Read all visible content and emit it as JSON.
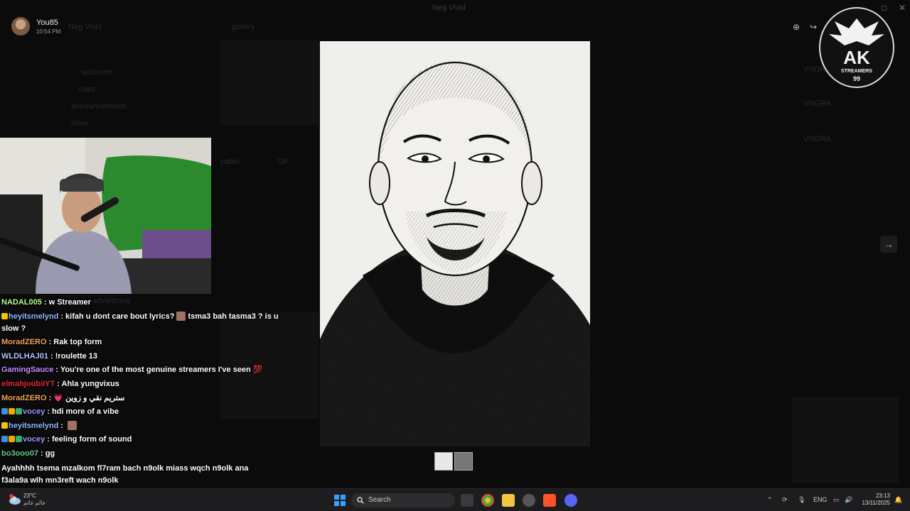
{
  "window": {
    "title": "Neg Vivid",
    "controls": [
      "–",
      "□",
      "✕"
    ]
  },
  "background_app": {
    "server_name": "Neg Vivid",
    "channel": "gallery",
    "sidebar_items": [
      "welcome",
      "rules",
      "announcements",
      "roles",
      "advertising"
    ],
    "post_author": "pablo",
    "post_badge": "OP",
    "members": [
      "VNGRA",
      "VNGRA",
      "VNGRA"
    ]
  },
  "viewer": {
    "user": {
      "name": "You85",
      "time": "10:54 PM"
    },
    "toolbar": [
      {
        "name": "zoom-icon",
        "glyph": "⊕"
      },
      {
        "name": "forward-icon",
        "glyph": "↪"
      }
    ],
    "next_glyph": "→",
    "thumbnails": 2
  },
  "overlay": {
    "logo_text": "AK",
    "logo_subtext": "STREAMERS",
    "logo_sub2": "99"
  },
  "chat": [
    {
      "user": "NADAL005",
      "color": "#b6ff8f",
      "badges": [],
      "text": "w Streamer"
    },
    {
      "user": "heyitsmelynd",
      "color": "#8fb7ff",
      "badges": [
        "#f7c400"
      ],
      "text": "kifah u dont care bout lyrics?",
      "emote": true,
      "text2": "tsma3 bah tasma3 ? is u slow ?"
    },
    {
      "user": "MoradZERO",
      "color": "#f0a35a",
      "badges": [],
      "text": "Rak top form"
    },
    {
      "user": "WLDLHAJ01",
      "color": "#b0c4ff",
      "badges": [],
      "text": "!roulette 13"
    },
    {
      "user": "GamingSauce",
      "color": "#c98cff",
      "badges": [],
      "text": "You're one of the most genuine streamers I've seen 💯"
    },
    {
      "user": "elmahjoubiIYT",
      "color": "#e0283c",
      "badges": [],
      "text": "Ahla yungvixus"
    },
    {
      "user": "MoradZERO",
      "color": "#f0a35a",
      "badges": [],
      "text": "💗 ستريم نقي و زوين"
    },
    {
      "user": "vocey",
      "color": "#9a9aff",
      "badges": [
        "#3f8fe0",
        "#f2a900",
        "#2db36b"
      ],
      "text": "hdi more of a vibe"
    },
    {
      "user": "heyitsmelynd",
      "color": "#8fb7ff",
      "badges": [
        "#f7c400"
      ],
      "text": "",
      "emote": true
    },
    {
      "user": "vocey",
      "color": "#9a9aff",
      "badges": [
        "#3f8fe0",
        "#f2a900",
        "#2db36b"
      ],
      "text": "feeling form of sound"
    },
    {
      "user": "bo3ooo07",
      "color": "#5ed18a",
      "badges": [],
      "text": "gg"
    }
  ],
  "plain_message": "Ayahhhh tsema mzalkom fl7ram bach n9olk miass wqch n9olk ana f3ala9a wlh mn3reft wach n9olk",
  "taskbar": {
    "weather_temp": "23°C",
    "weather_cond": "عالم غائم",
    "search_label": "Search",
    "lang": "ENG",
    "time": "23:13",
    "date": "13/11/2025"
  }
}
